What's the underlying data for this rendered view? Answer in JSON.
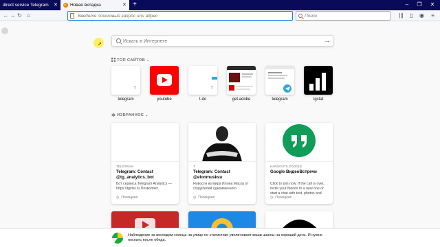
{
  "tabs": [
    {
      "title": "direct service Telegram"
    },
    {
      "title": "Новая вкладка"
    }
  ],
  "urlbar": {
    "placeholder": "Введите поисковый запрос или адрес"
  },
  "searchbar": {
    "placeholder": "Поиск"
  },
  "page_search": {
    "placeholder": "Искать в Интернете"
  },
  "top_sites": {
    "title": "ТОП САЙТОВ",
    "items": [
      {
        "label": "telegram",
        "letter": "T"
      },
      {
        "label": "youtube"
      },
      {
        "label": "t-do",
        "letter": "T"
      },
      {
        "label": "get.adobe"
      },
      {
        "label": "telegram"
      },
      {
        "label": "tgstat"
      }
    ]
  },
  "highlights": {
    "title": "ИЗБРАННОЕ",
    "cards": [
      {
        "source": "TELEGRAM",
        "title": "Telegram: Contact @tg_analytics_bot",
        "desc": "Бот сервиса Telegram Analytics — https://tgstat.ru Позволяет",
        "context": "Посещено"
      },
      {
        "source": "T",
        "title": "Telegram: Contact @elonmusksu",
        "desc": "Новости из мира Илона Маска от создателей одноименного",
        "context": "Посещено"
      },
      {
        "source": "HANGOUTS.GOOGLE",
        "title": "Google ВидеоВстречи",
        "desc": "Click to join now. If the call is over, invite your friends to a new one or start a chat with text, photos and",
        "context": "Посещено"
      }
    ]
  },
  "notification": {
    "text": "Наблюдение за восходом солнца на улице по статистике увеличивает ваши шансы на хороший день. И нужно поспать после обеда."
  },
  "colors": {
    "tabbar": "#0a0a5a",
    "accent": "#0a84ff",
    "youtube": "#ff0000",
    "hangouts": "#0f9d58"
  }
}
